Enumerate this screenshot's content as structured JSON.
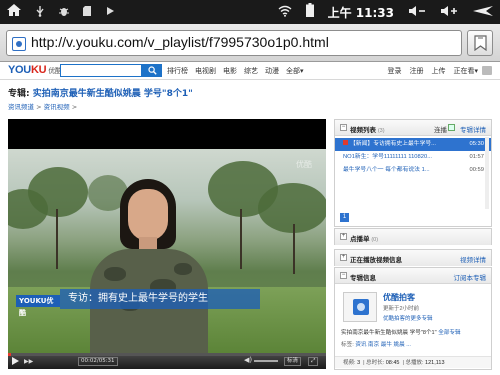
{
  "status_bar": {
    "time": "11:33",
    "ampm": "上午",
    "icons": [
      "home-icon",
      "usb-icon",
      "bug-icon",
      "sd-card-icon",
      "media-icon",
      "wifi-icon",
      "battery-icon",
      "volume-down-icon",
      "volume-up-icon",
      "back-icon"
    ]
  },
  "browser": {
    "url": "http://v.youku.com/v_playlist/f7995730o1p0.html"
  },
  "youku_header": {
    "logo_you": "YOU",
    "logo_ku": "KU",
    "logo_sub": "优酷",
    "search_button": "🔍",
    "nav": [
      "排行榜",
      "电视剧",
      "电影",
      "综艺",
      "动漫",
      "全部▾"
    ],
    "user_links": [
      "登录",
      "注册",
      "上传",
      "正在看▾"
    ]
  },
  "page": {
    "title_prefix": "专辑:",
    "title_text": "实拍南京最牛新生酷似姚晨 学号\"8个1\"",
    "breadcrumb_1": "资讯频道",
    "breadcrumb_sep": ">",
    "breadcrumb_2": "资讯视频",
    "breadcrumb_end": ">"
  },
  "player": {
    "watermark": "优酷",
    "caption_logo": "YOUKU优酷",
    "caption_text": "专访：拥有史上最牛学号的学生",
    "time_display": "00:02/05:31",
    "progress_fraction": 0.01,
    "buttons": [
      "标清",
      "⤢"
    ]
  },
  "playlist": {
    "title": "视频列表",
    "count": "(3)",
    "autoplay_label": "连播",
    "detail_link": "专辑详情",
    "items": [
      {
        "label": "【新闻】专访拥有史上最牛学号...",
        "duration": "05:30",
        "active": true
      },
      {
        "label": "NO1新生：学号11111111 110820...",
        "duration": "01:57",
        "active": false
      },
      {
        "label": "最牛学号八个一 每个都有说法 1...",
        "duration": "00:59",
        "active": false
      }
    ],
    "page": "1"
  },
  "dianbo": {
    "title": "点播单",
    "count": "(0)"
  },
  "now_playing": {
    "title": "正在播放视频信息",
    "link": "视频详情"
  },
  "album_info": {
    "title": "专辑信息",
    "link": "订阅本专辑",
    "uploader": "优酷拍客",
    "updated": "更新于2小时前",
    "uploader_link": "优酷拍客的更多专辑",
    "desc_prefix": "实拍南京最牛新生酷似姚晨 学号\"8个1\"",
    "desc_link": "全部专辑",
    "tags_label": "标签:",
    "tags": "资讯 南京 最牛 姚晨 ...",
    "stats_videos_label": "视频:",
    "stats_videos": "3",
    "stats_length_label": "总时长:",
    "stats_length": "08:45",
    "stats_plays_label": "总播放:",
    "stats_plays": "121,113"
  }
}
